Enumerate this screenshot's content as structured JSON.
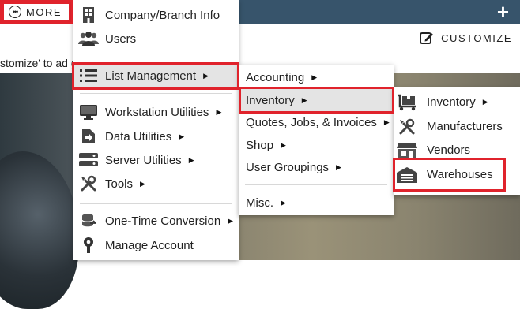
{
  "header": {
    "more_label": "MORE",
    "customize_label": "CUSTOMIZE"
  },
  "background_text": "stomize' to ad                                                          ging those insights.",
  "menu": {
    "items": [
      {
        "label": "Company/Branch Info",
        "icon": "building-icon"
      },
      {
        "label": "Users",
        "icon": "users-icon"
      },
      {
        "label": "List Management",
        "icon": "list-icon"
      },
      {
        "label": "Workstation Utilities",
        "icon": "monitor-icon"
      },
      {
        "label": "Data Utilities",
        "icon": "file-arrow-icon"
      },
      {
        "label": "Server Utilities",
        "icon": "server-icon"
      },
      {
        "label": "Tools",
        "icon": "tools-icon"
      },
      {
        "label": "One-Time Conversion",
        "icon": "database-convert-icon"
      },
      {
        "label": "Manage Account",
        "icon": "account-logo-icon"
      }
    ]
  },
  "list_submenu": {
    "items": [
      {
        "label": "Accounting"
      },
      {
        "label": "Inventory"
      },
      {
        "label": "Quotes, Jobs, & Invoices"
      },
      {
        "label": "Shop"
      },
      {
        "label": "User Groupings"
      },
      {
        "label": "Misc."
      }
    ]
  },
  "inventory_submenu": {
    "items": [
      {
        "label": "Inventory",
        "icon": "dolly-icon"
      },
      {
        "label": "Manufacturers",
        "icon": "tools-icon"
      },
      {
        "label": "Vendors",
        "icon": "storefront-icon"
      },
      {
        "label": "Warehouses",
        "icon": "warehouse-icon"
      }
    ]
  },
  "colors": {
    "header_bar": "#37546b",
    "highlight_box": "#e0232c",
    "hover_bg": "#e4e4e4"
  }
}
